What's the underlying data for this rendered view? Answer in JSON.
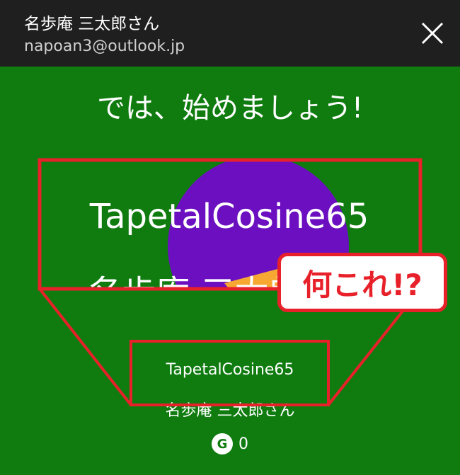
{
  "header": {
    "user_name": "名歩庵 三太郎さん",
    "user_email": "napoan3@outlook.jp"
  },
  "main": {
    "heading": "では、始めましょう!",
    "gamertag": "TapetalCosine65",
    "display_name": "名歩庵 三太郎さん",
    "gamerscore": "0",
    "gamerscore_icon": "G"
  },
  "annotation": {
    "callout_text": "何これ!?"
  },
  "colors": {
    "background": "#107c10",
    "titlebar": "#1f1f1f",
    "avatar_purple": "#6b0fc1",
    "avatar_orange": "#f7a833",
    "annotation_red": "#e8202a"
  }
}
